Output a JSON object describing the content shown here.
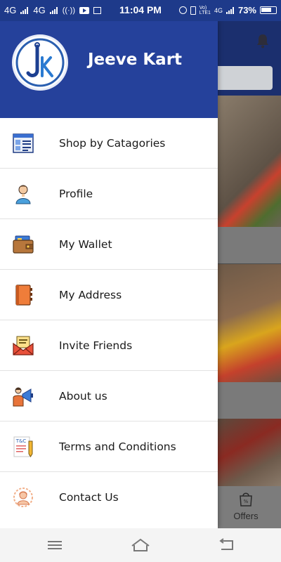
{
  "status_bar": {
    "network_left_1": "4G",
    "network_left_2": "4G",
    "time": "11:04 PM",
    "volte": "Vo)\nLTE1",
    "network_right": "4G",
    "battery": "73%"
  },
  "drawer": {
    "brand_name": "Jeeve Kart",
    "logo_letters": "JK",
    "items": [
      {
        "label": "Shop by Catagories",
        "icon": "catalog-icon"
      },
      {
        "label": "Profile",
        "icon": "user-icon"
      },
      {
        "label": "My Wallet",
        "icon": "wallet-icon"
      },
      {
        "label": "My Address",
        "icon": "address-book-icon"
      },
      {
        "label": "Invite Friends",
        "icon": "envelope-icon"
      },
      {
        "label": "About us",
        "icon": "megaphone-icon"
      },
      {
        "label": "Terms and Conditions",
        "icon": "terms-document-icon"
      },
      {
        "label": "Contact Us",
        "icon": "contact-icon"
      }
    ],
    "terms_icon_text": "T&C"
  },
  "background_app": {
    "offers_label": "Offers"
  },
  "colors": {
    "header_blue": "#25419b",
    "status_blue": "#1e3a8a",
    "divider": "#e2e2e2"
  }
}
